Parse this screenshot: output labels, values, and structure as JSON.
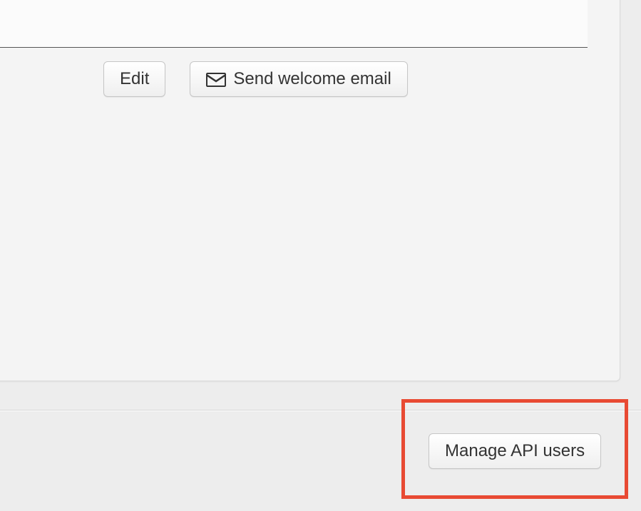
{
  "actions": {
    "edit_label": "Edit",
    "send_welcome_label": "Send welcome email"
  },
  "footer": {
    "manage_api_users_label": "Manage API users"
  }
}
